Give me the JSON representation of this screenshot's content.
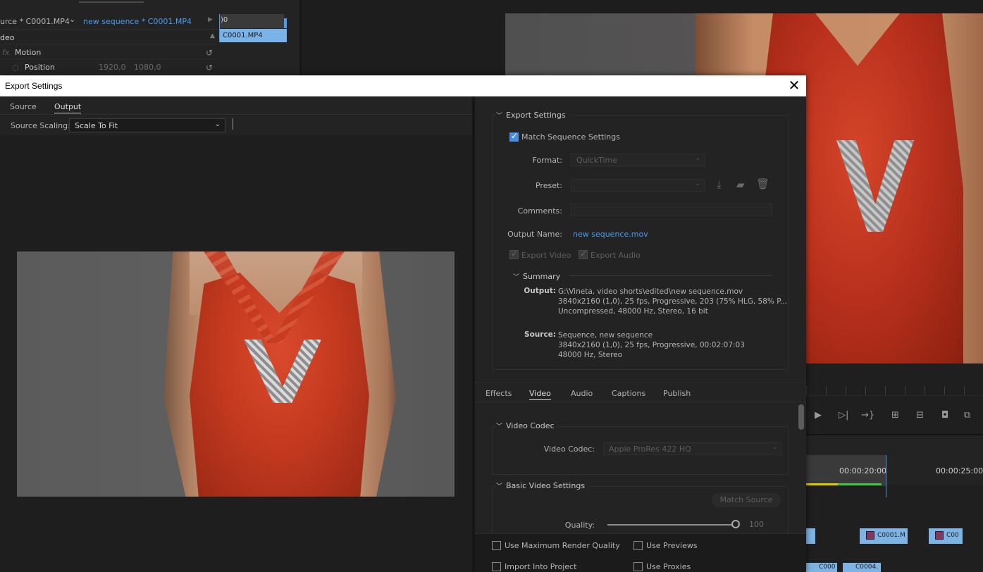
{
  "background": {
    "source_tab": "urce * C0001.MP4",
    "sequence_tab": "new sequence * C0001.MP4",
    "rows": {
      "video": "deo",
      "fx": "fx",
      "motion": "Motion",
      "position": "Position",
      "pos_x": "1920,0",
      "pos_y": "1080,0"
    },
    "mini_timeline": {
      "ruler": ")0",
      "clip": "C0001.MP4"
    },
    "timeline": {
      "time1": "00:00:20:00",
      "time2": "00:00:25:00",
      "clips": [
        "C0001.M",
        "C00",
        "C000",
        "C0004."
      ]
    }
  },
  "dialog": {
    "title": "Export Settings",
    "close_glyph": "✕",
    "left_tabs": [
      "Source",
      "Output"
    ],
    "active_left_tab": "Output",
    "source_scaling_label": "Source Scaling:",
    "source_scaling_value": "Scale To Fit",
    "export_settings": {
      "header": "Export Settings",
      "match_sequence": "Match Sequence Settings",
      "format_label": "Format:",
      "format_value": "QuickTime",
      "preset_label": "Preset:",
      "preset_value": "",
      "comments_label": "Comments:",
      "output_name_label": "Output Name:",
      "output_name_value": "new sequence.mov",
      "export_video": "Export Video",
      "export_audio": "Export Audio"
    },
    "summary": {
      "header": "Summary",
      "output_label": "Output:",
      "output_lines": "G:\\Vineta, video shorts\\edited\\new sequence.mov\n3840x2160 (1,0), 25 fps, Progressive, 203 (75% HLG, 58% P...\nUncompressed, 48000 Hz, Stereo, 16 bit",
      "source_label": "Source:",
      "source_lines": "Sequence, new sequence\n3840x2160 (1,0), 25 fps, Progressive, 00:02:07:03\n48000 Hz, Stereo"
    },
    "tabs": [
      "Effects",
      "Video",
      "Audio",
      "Captions",
      "Publish"
    ],
    "active_tab": "Video",
    "video_codec": {
      "header": "Video Codec",
      "label": "Video Codec:",
      "value": "Apple ProRes 422 HQ"
    },
    "basic_video": {
      "header": "Basic Video Settings",
      "match_source": "Match Source",
      "quality_label": "Quality:",
      "quality_value": "100",
      "quality_fraction": 1.0
    },
    "bottom": {
      "max_render": "Use Maximum Render Quality",
      "use_previews": "Use Previews",
      "import_project": "Import Into Project",
      "use_proxies": "Use Proxies"
    }
  },
  "colors": {
    "accent": "#4b9cf0",
    "checkbox": "#4a8ee0"
  }
}
